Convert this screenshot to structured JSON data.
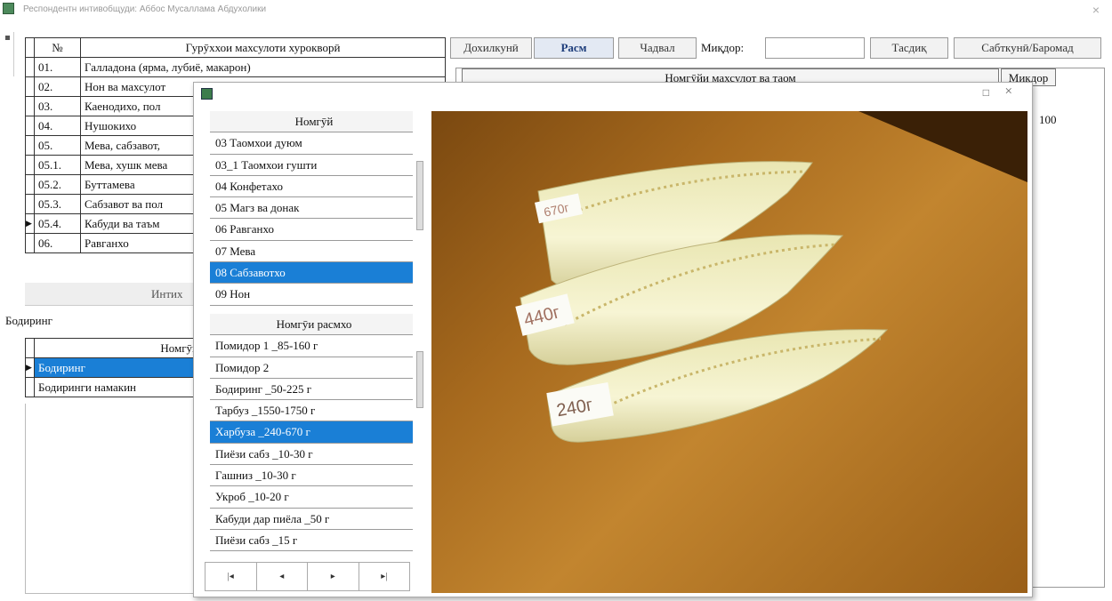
{
  "window": {
    "title": "Респондентн интивобщуди: Аббос Мусаллама Абдухолики",
    "close": "×"
  },
  "left_table": {
    "headers": [
      "№",
      "Гурӯххои махсулоти хурокворӣ"
    ],
    "rows": [
      {
        "num": "01.",
        "name": "Галладона (ярма, лубиё, макарон)"
      },
      {
        "num": "02.",
        "name": "Нон ва махсулот"
      },
      {
        "num": "03.",
        "name": "Каенодихо, пол"
      },
      {
        "num": "04.",
        "name": "Нушокихо"
      },
      {
        "num": "05.",
        "name": "Мева, сабзавот, "
      },
      {
        "num": "05.1.",
        "name": "Мева, хушк мева"
      },
      {
        "num": "05.2.",
        "name": "Буттамева"
      },
      {
        "num": "05.3.",
        "name": "Сабзавот ва пол"
      },
      {
        "num": "05.4.",
        "name": "Кабуди ва таъм"
      },
      {
        "num": "06.",
        "name": "Равганхо"
      }
    ],
    "selected_index": 8
  },
  "left_bottom": {
    "section_label": "Интих",
    "field_value": "Бодиринг",
    "header": "Номгӯй",
    "items": [
      "Бодиринг",
      "Бодиринги намакин"
    ]
  },
  "tabs": [
    "Дохилкунӣ",
    "Расм",
    "Чадвал",
    "Миқдор:",
    "Тасдиқ",
    "Сабткунӣ/Баромад"
  ],
  "right_table": {
    "header": "Номгӯйи махсулот ва таом",
    "col2": "Миқдор",
    "value": "100"
  },
  "popup": {
    "max_icon": "□",
    "close": "×",
    "list1_header": "Номгӯй",
    "list1": [
      "03 Таомхои дуюм",
      "03_1 Таомхои гушти",
      "04 Конфетахо",
      "05 Магз ва донак",
      "06 Равганхо",
      "07 Мева",
      "08 Сабзавотхо",
      "09 Нон"
    ],
    "list1_selected": 6,
    "list2_header": "Номгӯи расмхо",
    "list2": [
      "Помидор 1 _85-160 г",
      "Помидор 2",
      "Бодиринг _50-225 г",
      "Тарбуз _1550-1750 г",
      "Харбуза _240-670 г",
      "Пиёзи сабз _10-30 г",
      "Гашниз _10-30 г",
      "Укроб _10-20 г",
      "Кабуди дар пиёла _50 г",
      "Пиёзи сабз _15 г"
    ],
    "list2_selected": 4,
    "nav": [
      "|◂",
      "◂",
      "▸",
      "▸|"
    ],
    "photo_labels": [
      "670г",
      "440г",
      "240г"
    ]
  },
  "colors": {
    "accent": "#1a7fd6",
    "table_wood": "#a76a1e",
    "melon": "#f4f1c8"
  }
}
